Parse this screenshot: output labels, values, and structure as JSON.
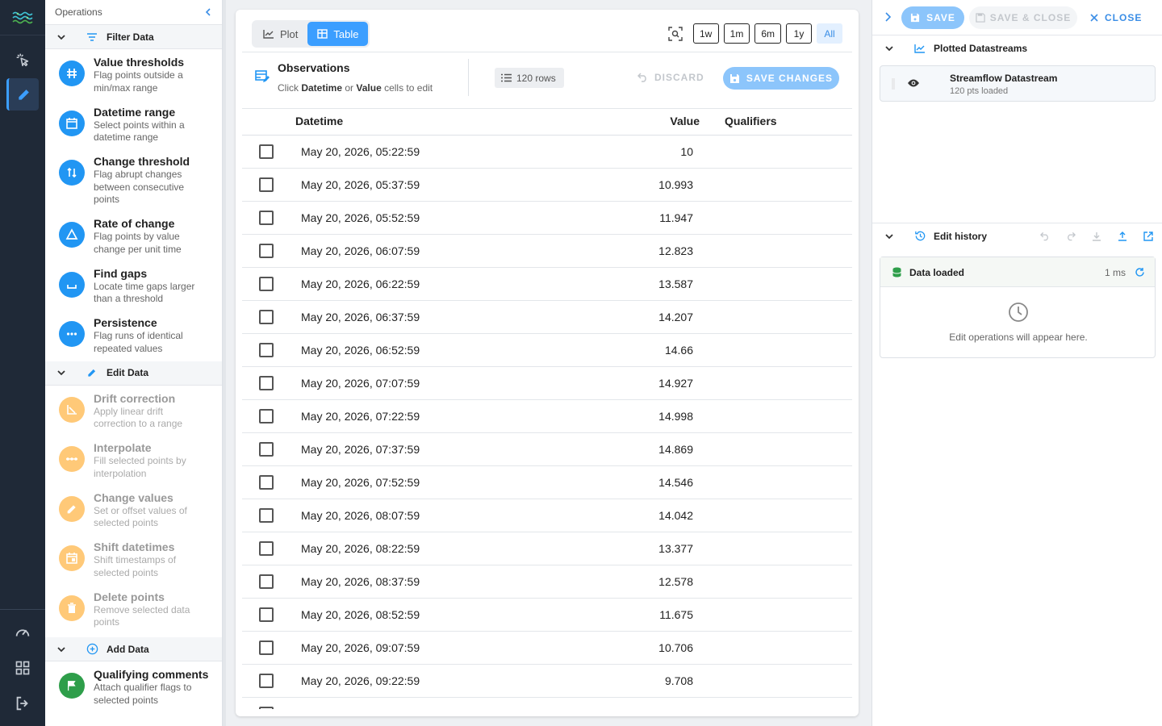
{
  "operations_panel": {
    "title": "Operations",
    "sections": [
      {
        "label": "Filter Data",
        "items": [
          {
            "title": "Value thresholds",
            "desc": "Flag points outside a min/max range"
          },
          {
            "title": "Datetime range",
            "desc": "Select points within a datetime range"
          },
          {
            "title": "Change threshold",
            "desc": "Flag abrupt changes between consecutive points"
          },
          {
            "title": "Rate of change",
            "desc": "Flag points by value change per unit time"
          },
          {
            "title": "Find gaps",
            "desc": "Locate time gaps larger than a threshold"
          },
          {
            "title": "Persistence",
            "desc": "Flag runs of identical repeated values"
          }
        ]
      },
      {
        "label": "Edit Data",
        "items": [
          {
            "title": "Drift correction",
            "desc": "Apply linear drift correction to a range"
          },
          {
            "title": "Interpolate",
            "desc": "Fill selected points by interpolation"
          },
          {
            "title": "Change values",
            "desc": "Set or offset values of selected points"
          },
          {
            "title": "Shift datetimes",
            "desc": "Shift timestamps of selected points"
          },
          {
            "title": "Delete points",
            "desc": "Remove selected data points"
          }
        ]
      },
      {
        "label": "Add Data",
        "items": [
          {
            "title": "Qualifying comments",
            "desc": "Attach qualifier flags to selected points"
          }
        ]
      }
    ]
  },
  "colors": {
    "accent": "#3b9eff",
    "filter_icon_bg": "#2196f3",
    "edit_icon_bg": "#ffc978",
    "add_icon_bg": "#2e9e4a",
    "rail_bg": "#1f2937"
  },
  "view_toggle": {
    "plot": "Plot",
    "table": "Table",
    "active": "Table"
  },
  "time_ranges": [
    "1w",
    "1m",
    "6m",
    "1y",
    "All"
  ],
  "active_range": "All",
  "observations": {
    "title": "Observations",
    "hint_prefix": "Click",
    "hint_datetime": "Datetime",
    "hint_or": "or",
    "hint_value": "Value",
    "hint_suffix": "cells to edit",
    "row_count": "120 rows",
    "discard_label": "DISCARD",
    "save_changes_label": "SAVE CHANGES"
  },
  "table": {
    "columns": {
      "datetime": "Datetime",
      "value": "Value",
      "qualifiers": "Qualifiers"
    },
    "rows": [
      {
        "datetime": "May 20, 2026, 05:22:59",
        "value": "10"
      },
      {
        "datetime": "May 20, 2026, 05:37:59",
        "value": "10.993"
      },
      {
        "datetime": "May 20, 2026, 05:52:59",
        "value": "11.947"
      },
      {
        "datetime": "May 20, 2026, 06:07:59",
        "value": "12.823"
      },
      {
        "datetime": "May 20, 2026, 06:22:59",
        "value": "13.587"
      },
      {
        "datetime": "May 20, 2026, 06:37:59",
        "value": "14.207"
      },
      {
        "datetime": "May 20, 2026, 06:52:59",
        "value": "14.66"
      },
      {
        "datetime": "May 20, 2026, 07:07:59",
        "value": "14.927"
      },
      {
        "datetime": "May 20, 2026, 07:22:59",
        "value": "14.998"
      },
      {
        "datetime": "May 20, 2026, 07:37:59",
        "value": "14.869"
      },
      {
        "datetime": "May 20, 2026, 07:52:59",
        "value": "14.546"
      },
      {
        "datetime": "May 20, 2026, 08:07:59",
        "value": "14.042"
      },
      {
        "datetime": "May 20, 2026, 08:22:59",
        "value": "13.377"
      },
      {
        "datetime": "May 20, 2026, 08:37:59",
        "value": "12.578"
      },
      {
        "datetime": "May 20, 2026, 08:52:59",
        "value": "11.675"
      },
      {
        "datetime": "May 20, 2026, 09:07:59",
        "value": "10.706"
      },
      {
        "datetime": "May 20, 2026, 09:22:59",
        "value": "9.708"
      },
      {
        "datetime": "",
        "value": ""
      }
    ]
  },
  "right_panel": {
    "save_label": "SAVE",
    "save_close_label": "SAVE & CLOSE",
    "close_label": "CLOSE",
    "plotted_title": "Plotted Datastreams",
    "datastream_name": "Streamflow Datastream",
    "datastream_sub": "120 pts loaded",
    "history_title": "Edit history",
    "history_entry": "Data loaded",
    "history_entry_time": "1 ms",
    "history_empty": "Edit operations will appear here."
  }
}
